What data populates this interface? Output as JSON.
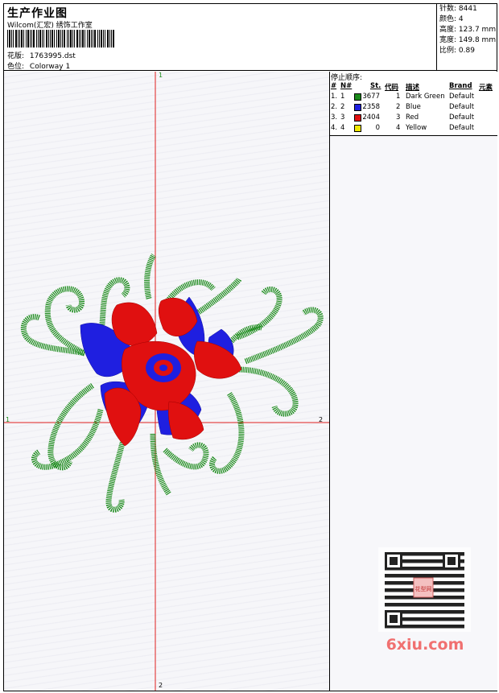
{
  "header": {
    "title": "生产作业图",
    "company": "Wilcom(汇宏) 绣饰工作室",
    "pattern_label": "花版:",
    "pattern_value": "1763995.dst",
    "colorway_label": "色位:",
    "colorway_value": "Colorway 1"
  },
  "stats": [
    {
      "label": "针数:",
      "value": "8441"
    },
    {
      "label": "颜色:",
      "value": "4"
    },
    {
      "label": "高度:",
      "value": "123.7 mm"
    },
    {
      "label": "宽度:",
      "value": "149.8 mm"
    },
    {
      "label": "比例:",
      "value": "0.89"
    }
  ],
  "stop_sequence": {
    "title": "停止顺序:",
    "headers": [
      "#",
      "N#",
      "St.",
      "代码",
      "描述",
      "Brand",
      "元素"
    ],
    "rows": [
      {
        "num": "1.",
        "n": "1",
        "color": "#1a8a1a",
        "st": "3677",
        "code": "1",
        "desc": "Dark Green",
        "brand": "Default"
      },
      {
        "num": "2.",
        "n": "2",
        "color": "#1f1fe0",
        "st": "2358",
        "code": "2",
        "desc": "Blue",
        "brand": "Default"
      },
      {
        "num": "3.",
        "n": "3",
        "color": "#e01010",
        "st": "2404",
        "code": "3",
        "desc": "Red",
        "brand": "Default"
      },
      {
        "num": "4.",
        "n": "4",
        "color": "#f0e800",
        "st": "0",
        "code": "4",
        "desc": "Yellow",
        "brand": "Default"
      }
    ]
  },
  "axes": {
    "top": "1",
    "left": "1",
    "right": "2",
    "bottom": "2"
  },
  "watermark": {
    "text": "6xiu.com",
    "stamp": "花型网"
  },
  "colors": {
    "green": "#1a8a1a",
    "blue": "#1f1fe0",
    "red": "#e01010",
    "axis": "#e02020"
  }
}
